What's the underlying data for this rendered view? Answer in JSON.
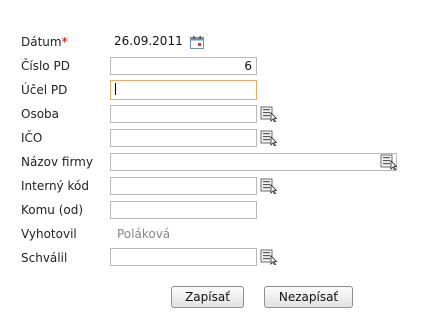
{
  "form": {
    "datum": {
      "label": "Dátum",
      "required_mark": "*",
      "value": "26.09.2011",
      "icon": "calendar-icon"
    },
    "cislo_pd": {
      "label": "Číslo PD",
      "value": "6"
    },
    "ucel_pd": {
      "label": "Účel PD",
      "value": ""
    },
    "osoba": {
      "label": "Osoba",
      "value": "",
      "icon": "lookup-icon"
    },
    "ico": {
      "label": "IČO",
      "value": "",
      "icon": "lookup-icon"
    },
    "nazov_firmy": {
      "label": "Názov firmy",
      "value": "",
      "icon": "lookup-icon"
    },
    "interny_kod": {
      "label": "Interný kód",
      "value": "",
      "icon": "lookup-icon"
    },
    "komu": {
      "label": "Komu (od)",
      "value": ""
    },
    "vyhotovil": {
      "label": "Vyhotovil",
      "value": "Poláková"
    },
    "schvalil": {
      "label": "Schválil",
      "value": "",
      "icon": "lookup-icon"
    }
  },
  "actions": {
    "save_label": "Zapísať",
    "cancel_label": "Nezapísať"
  },
  "colors": {
    "required": "#cc0000",
    "focus_border": "#e0b064",
    "field_border": "#b9b9b9",
    "readonly_text": "#888888"
  }
}
